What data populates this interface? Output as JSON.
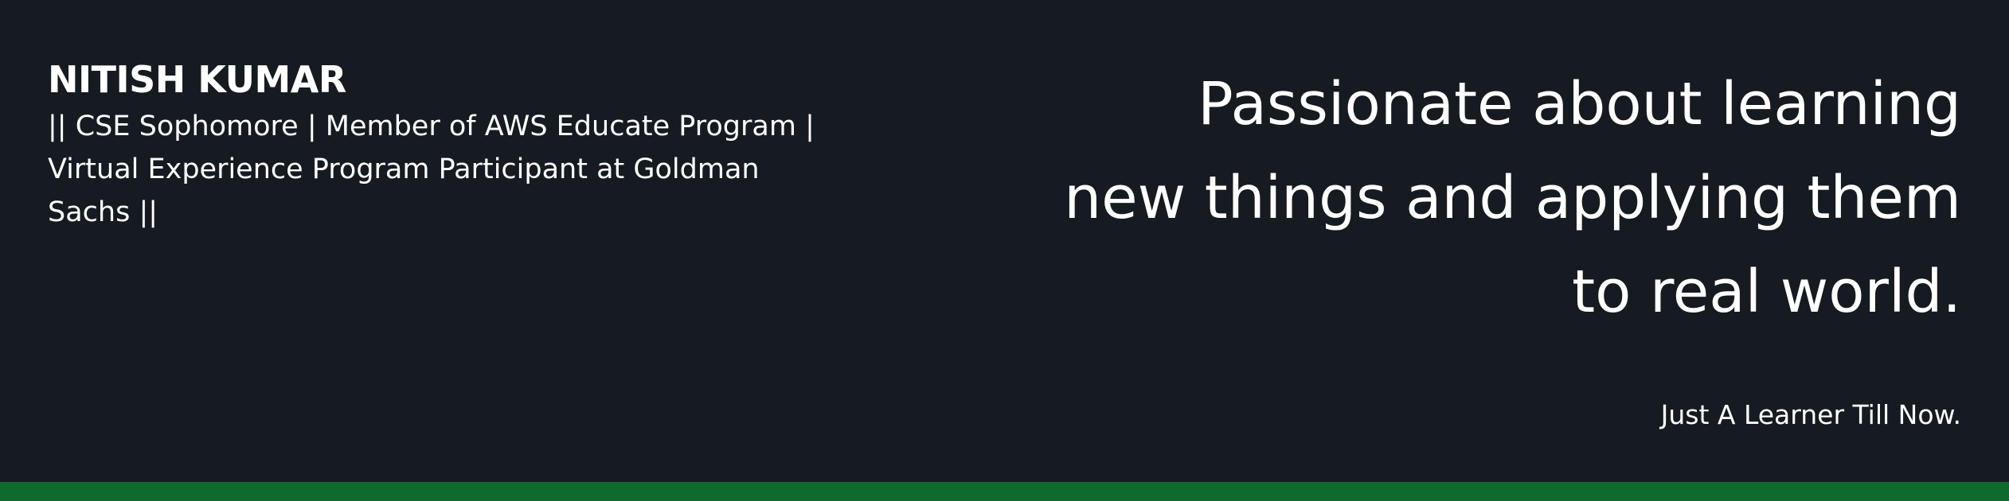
{
  "profile": {
    "name": "NITISH KUMAR",
    "bio": "|| CSE Sophomore | Member of AWS Educate Program | Virtual Experience Program Participant at Goldman Sachs ||"
  },
  "hero": {
    "headline_lines": [
      "Passionate about learning",
      "new things and applying them",
      "to real world."
    ],
    "tagline": "Just A Learner Till Now."
  },
  "colors": {
    "background": "#161a21",
    "text": "#ffffff",
    "accent_bar": "#10692d"
  }
}
